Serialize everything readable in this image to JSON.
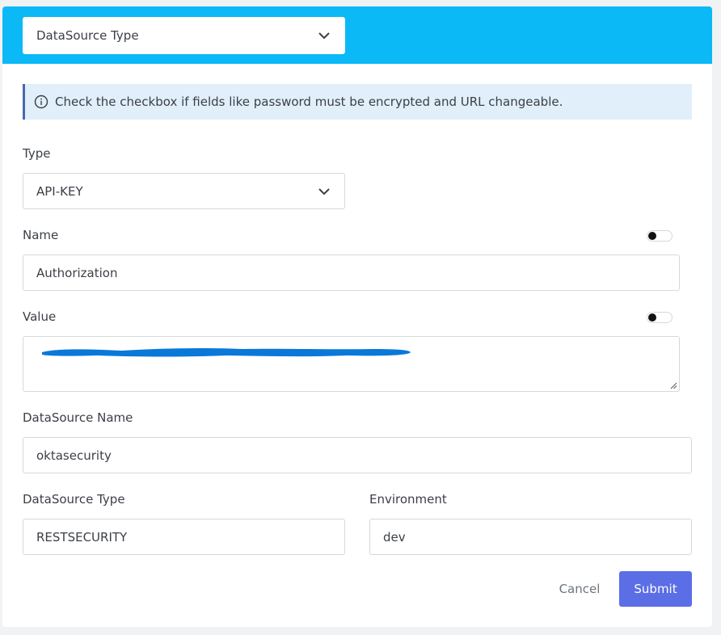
{
  "header": {
    "datasource_type_select": "DataSource Type"
  },
  "info_alert": {
    "icon": "info-icon",
    "text": "Check the checkbox if fields like password must be encrypted and URL changeable."
  },
  "form": {
    "type": {
      "label": "Type",
      "value": "API-KEY"
    },
    "name": {
      "label": "Name",
      "value": "Authorization",
      "toggle_on": false
    },
    "value": {
      "label": "Value",
      "value": "",
      "redacted": true,
      "toggle_on": false
    },
    "datasource_name": {
      "label": "DataSource Name",
      "value": "oktasecurity"
    },
    "datasource_type": {
      "label": "DataSource Type",
      "value": "RESTSECURITY"
    },
    "environment": {
      "label": "Environment",
      "value": "dev"
    }
  },
  "actions": {
    "cancel_label": "Cancel",
    "submit_label": "Submit"
  },
  "colors": {
    "header_bg": "#0bb9f7",
    "alert_bg": "#e1effa",
    "alert_border": "#4869b0",
    "submit_bg": "#5b6ee6",
    "redaction": "#0a78d9"
  }
}
